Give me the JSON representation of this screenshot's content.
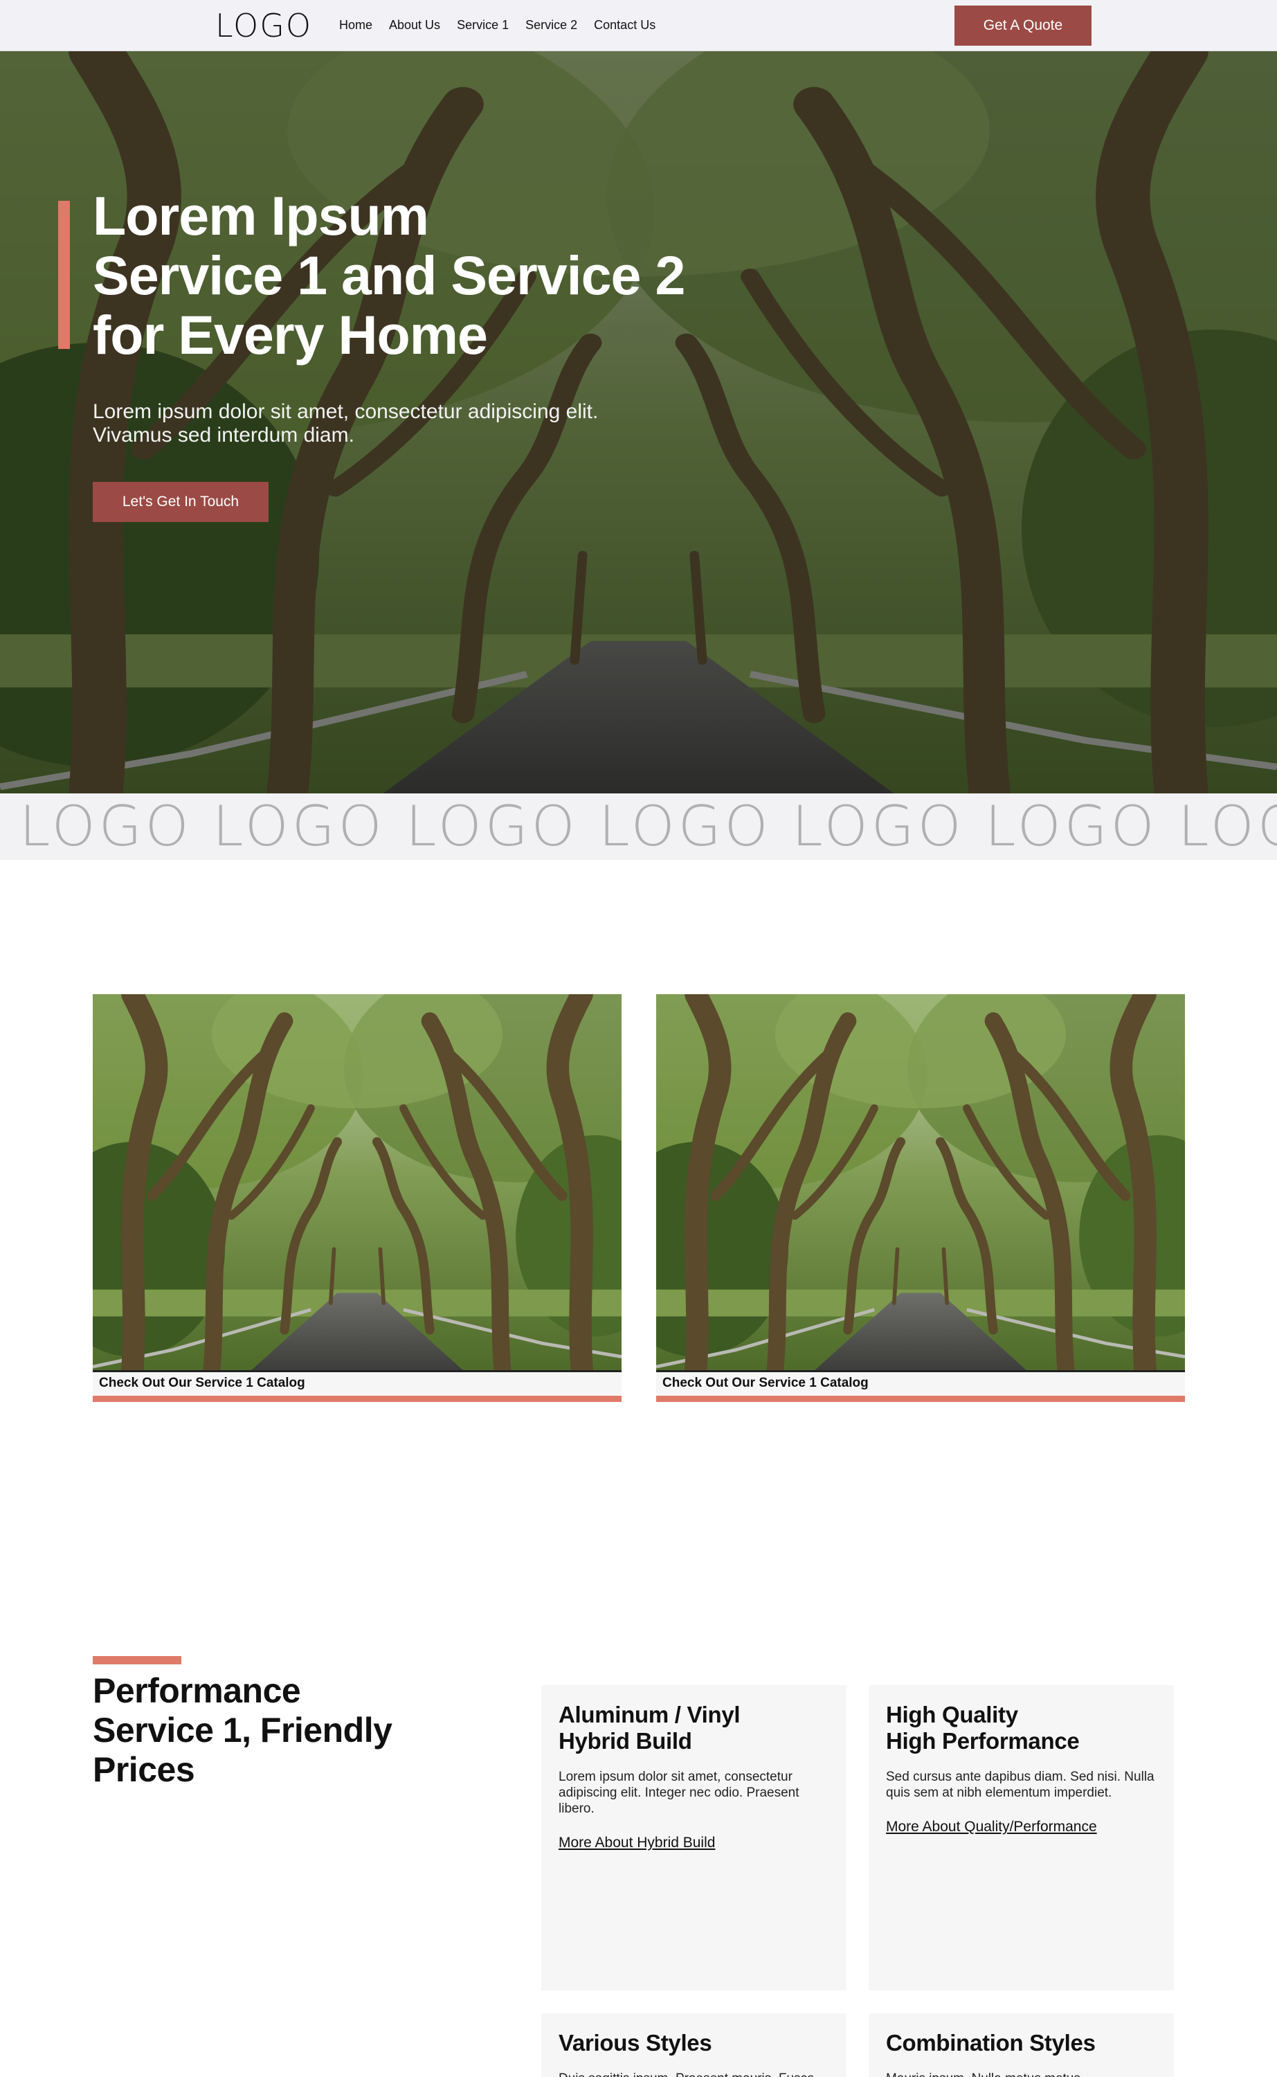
{
  "header": {
    "logo": "LOGO",
    "nav": [
      "Home",
      "About Us",
      "Service 1",
      "Service 2",
      "Contact Us"
    ],
    "quote_button": "Get A Quote"
  },
  "hero": {
    "title_lines": [
      "Lorem Ipsum",
      "Service 1 and Service 2",
      "for Every Home"
    ],
    "subtitle_lines": [
      "Lorem ipsum dolor sit amet, consectetur adipiscing elit.",
      "Vivamus sed interdum diam."
    ],
    "cta": "Let's Get In Touch"
  },
  "logo_strip": [
    "LOGO",
    "LOGO",
    "LOGO",
    "LOGO",
    "LOGO",
    "LOGO",
    "LOGO"
  ],
  "catalog": [
    {
      "caption": "Check Out Our Service 1 Catalog"
    },
    {
      "caption": "Check Out Our Service 1 Catalog"
    }
  ],
  "features": {
    "title_lines": [
      "Performance",
      "Service 1, Friendly",
      "Prices"
    ],
    "cards": [
      {
        "title_lines": [
          "Aluminum / Vinyl",
          "Hybrid Build"
        ],
        "body": "Lorem ipsum dolor sit amet, consectetur adipiscing elit. Integer nec odio. Praesent libero.",
        "link": "More About Hybrid Build"
      },
      {
        "title_lines": [
          "High Quality",
          "High Performance"
        ],
        "body": "Sed cursus ante dapibus diam. Sed nisi. Nulla quis sem at nibh elementum imperdiet.",
        "link": "More About Quality/Performance"
      },
      {
        "title_lines": [
          "Various Styles"
        ],
        "body": "Duis sagittis ipsum. Praesent mauris. Fusce",
        "link": ""
      },
      {
        "title_lines": [
          "Combination Styles"
        ],
        "body": "Mauris ipsum. Nulla metus metus,",
        "link": ""
      }
    ]
  },
  "colors": {
    "accent": "#e07a68",
    "button": "#9b4a45",
    "header_bg": "#f2f2f6",
    "card_bg": "#f6f6f6"
  },
  "images": {
    "hero_background": "tree-lined-road-photo",
    "catalog_photo": "tree-lined-road-photo"
  }
}
